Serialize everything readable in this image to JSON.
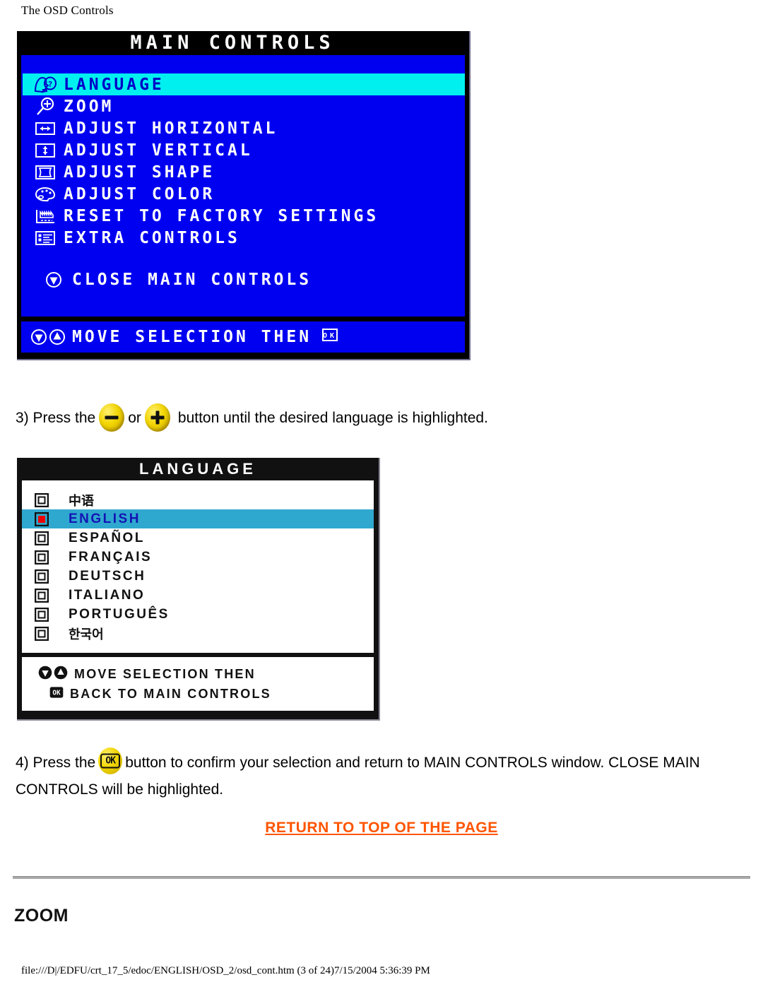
{
  "page": {
    "header": "The OSD Controls",
    "footer_path": "file:///D|/EDFU/crt_17_5/edoc/ENGLISH/OSD_2/osd_cont.htm (3 of 24)7/15/2004 5:36:39 PM",
    "section_heading": "ZOOM",
    "return_link": "RETURN TO TOP OF THE PAGE",
    "accent_link_color": "#ff5500",
    "rule_color": "#a9a9a9"
  },
  "main_controls": {
    "title": "MAIN CONTROLS",
    "title_bg": "#000000",
    "body_bg": "#0000f0",
    "highlight_bg": "#00f0f0",
    "highlight_text_color": "#0000c8",
    "text_color": "#ffffff",
    "items": [
      {
        "icon": "language-faces-icon",
        "label": "LANGUAGE",
        "highlighted": true
      },
      {
        "icon": "magnifier-plus-icon",
        "label": "ZOOM",
        "highlighted": false
      },
      {
        "icon": "adjust-horizontal-icon",
        "label": "ADJUST HORIZONTAL",
        "highlighted": false
      },
      {
        "icon": "adjust-vertical-icon",
        "label": "ADJUST VERTICAL",
        "highlighted": false
      },
      {
        "icon": "adjust-shape-icon",
        "label": "ADJUST SHAPE",
        "highlighted": false
      },
      {
        "icon": "adjust-color-palette-icon",
        "label": "ADJUST COLOR",
        "highlighted": false
      },
      {
        "icon": "factory-reset-icon",
        "label": "RESET TO FACTORY SETTINGS",
        "highlighted": false
      },
      {
        "icon": "extra-controls-list-icon",
        "label": "EXTRA CONTROLS",
        "highlighted": false
      }
    ],
    "close_item": {
      "icon": "down-arrow-circle-icon",
      "label": "CLOSE MAIN CONTROLS"
    },
    "footer": {
      "icons": [
        "down-arrow-circle-icon",
        "up-arrow-circle-icon"
      ],
      "label": "MOVE SELECTION THEN",
      "trailing_icon": "ok-button-icon",
      "trailing_icon_label": "OK"
    }
  },
  "language_menu": {
    "title": "LANGUAGE",
    "title_bg": "#111111",
    "body_bg": "#ffffff",
    "highlight_bg": "#2fa8cf",
    "highlight_text_color": "#1414b4",
    "selected_radio_color": "#ee0000",
    "items": [
      {
        "icon": "radio-unselected-icon",
        "label": "中语",
        "script": "cjk",
        "selected": false
      },
      {
        "icon": "radio-selected-icon",
        "label": "ENGLISH",
        "script": "latin",
        "selected": true
      },
      {
        "icon": "radio-unselected-icon",
        "label": "ESPAÑOL",
        "script": "latin",
        "selected": false
      },
      {
        "icon": "radio-unselected-icon",
        "label": "FRANÇAIS",
        "script": "latin",
        "selected": false
      },
      {
        "icon": "radio-unselected-icon",
        "label": "DEUTSCH",
        "script": "latin",
        "selected": false
      },
      {
        "icon": "radio-unselected-icon",
        "label": "ITALIANO",
        "script": "latin",
        "selected": false
      },
      {
        "icon": "radio-unselected-icon",
        "label": "PORTUGUÊS",
        "script": "latin",
        "selected": false
      },
      {
        "icon": "radio-unselected-icon",
        "label": "한국어",
        "script": "cjk",
        "selected": false
      }
    ],
    "footer": {
      "line1_icons": [
        "down-arrow-circle-icon",
        "up-arrow-circle-icon"
      ],
      "line1": "MOVE SELECTION THEN",
      "line2_icon": "ok-button-icon",
      "line2": "BACK TO MAIN CONTROLS"
    }
  },
  "steps": {
    "step3": {
      "prefix": "3) Press the",
      "minus_button": "minus-button",
      "conjunction": "or",
      "plus_button": "plus-button",
      "suffix": "button until the desired language is highlighted."
    },
    "step4": {
      "prefix": "4) Press the",
      "ok_button": "OK",
      "suffix": "button to confirm your selection and return to MAIN CONTROLS window. CLOSE MAIN CONTROLS will be highlighted."
    }
  }
}
